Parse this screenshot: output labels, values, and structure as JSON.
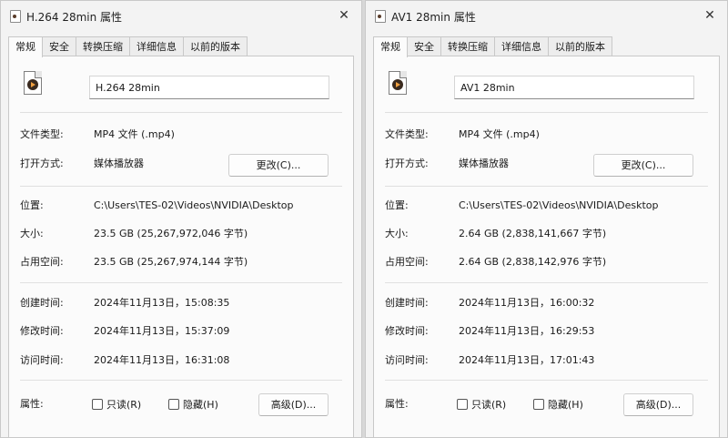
{
  "windows": [
    {
      "title": "H.264 28min 属性",
      "tabs": [
        "常规",
        "安全",
        "转换压缩",
        "详细信息",
        "以前的版本"
      ],
      "file_name": "H.264 28min",
      "file_type_label": "文件类型:",
      "file_type": "MP4 文件 (.mp4)",
      "open_with_label": "打开方式:",
      "open_with": "媒体播放器",
      "change_button": "更改(C)...",
      "location_label": "位置:",
      "location": "C:\\Users\\TES-02\\Videos\\NVIDIA\\Desktop",
      "size_label": "大小:",
      "size": "23.5 GB (25,267,972,046 字节)",
      "size_on_disk_label": "占用空间:",
      "size_on_disk": "23.5 GB (25,267,974,144 字节)",
      "created_label": "创建时间:",
      "created": "2024年11月13日，15:08:35",
      "modified_label": "修改时间:",
      "modified": "2024年11月13日，15:37:09",
      "accessed_label": "访问时间:",
      "accessed": "2024年11月13日，16:31:08",
      "attributes_label": "属性:",
      "readonly_label": "只读(R)",
      "hidden_label": "隐藏(H)",
      "advanced_button": "高级(D)..."
    },
    {
      "title": "AV1 28min 属性",
      "tabs": [
        "常规",
        "安全",
        "转换压缩",
        "详细信息",
        "以前的版本"
      ],
      "file_name": "AV1 28min",
      "file_type_label": "文件类型:",
      "file_type": "MP4 文件 (.mp4)",
      "open_with_label": "打开方式:",
      "open_with": "媒体播放器",
      "change_button": "更改(C)...",
      "location_label": "位置:",
      "location": "C:\\Users\\TES-02\\Videos\\NVIDIA\\Desktop",
      "size_label": "大小:",
      "size": "2.64 GB (2,838,141,667 字节)",
      "size_on_disk_label": "占用空间:",
      "size_on_disk": "2.64 GB (2,838,142,976 字节)",
      "created_label": "创建时间:",
      "created": "2024年11月13日，16:00:32",
      "modified_label": "修改时间:",
      "modified": "2024年11月13日，16:29:53",
      "accessed_label": "访问时间:",
      "accessed": "2024年11月13日，17:01:43",
      "attributes_label": "属性:",
      "readonly_label": "只读(R)",
      "hidden_label": "隐藏(H)",
      "advanced_button": "高级(D)..."
    }
  ],
  "icons": {
    "close": "close-icon",
    "file": "video-file-icon",
    "title": "window-file-icon"
  },
  "colors": {
    "window_bg": "#f3f3f3",
    "panel_bg": "#fbfbfb",
    "border": "#c8c8c8",
    "icon_orange": "#f0a040"
  }
}
